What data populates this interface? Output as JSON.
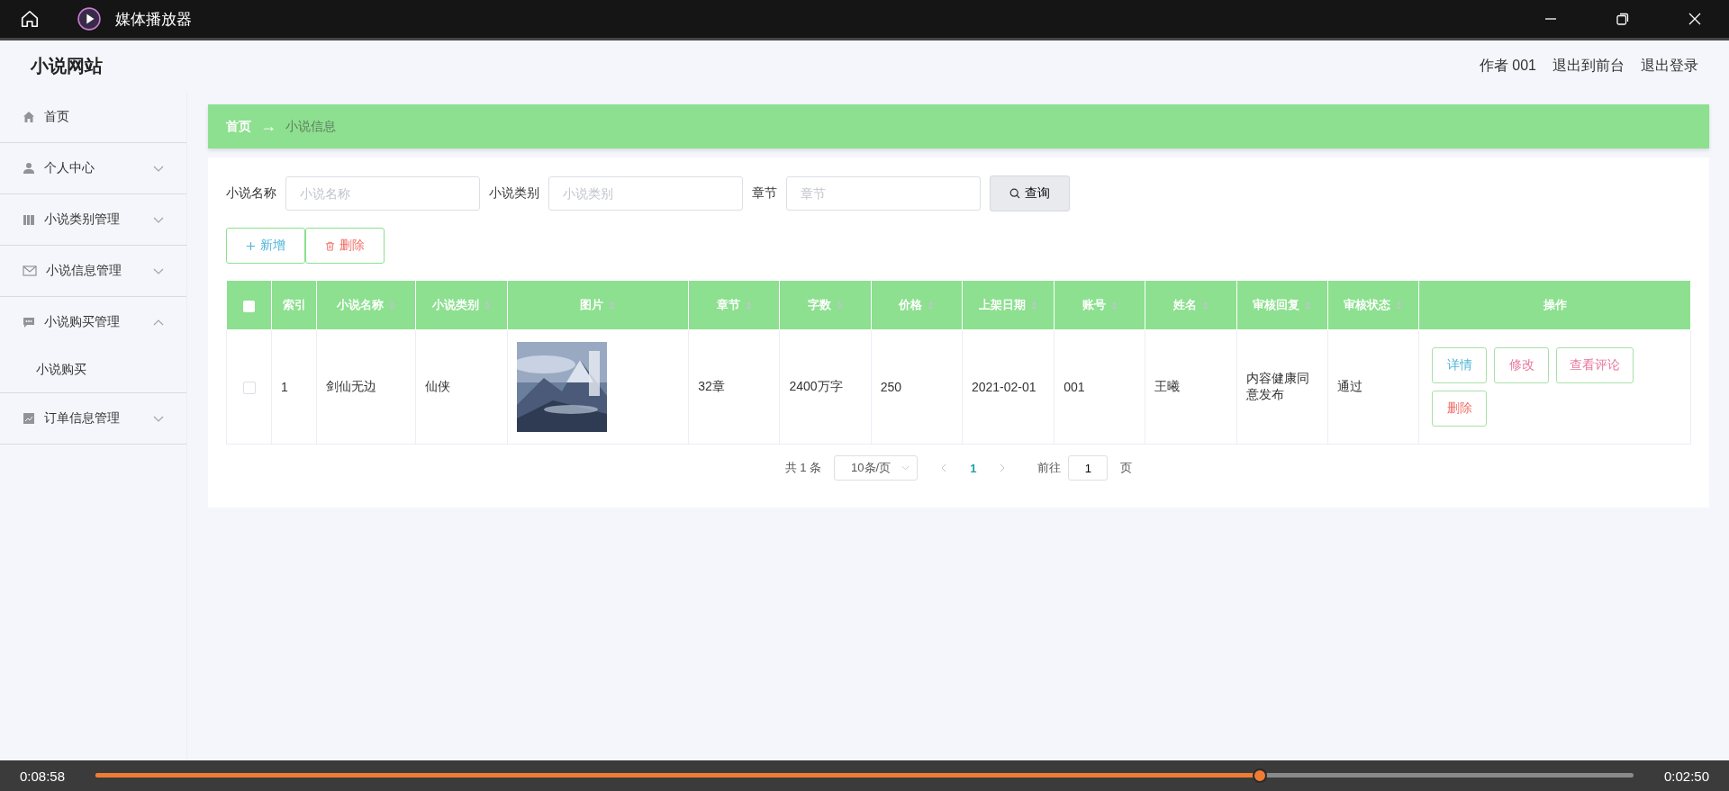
{
  "window": {
    "title": "媒体播放器"
  },
  "header": {
    "site_title": "小说网站",
    "user": "作者 001",
    "links": [
      "退出到前台",
      "退出登录"
    ]
  },
  "sidebar": {
    "items": [
      {
        "label": "首页"
      },
      {
        "label": "个人中心",
        "expanded": false
      },
      {
        "label": "小说类别管理",
        "expanded": false
      },
      {
        "label": "小说信息管理",
        "expanded": false
      },
      {
        "label": "小说购买管理",
        "expanded": true,
        "children": [
          {
            "label": "小说购买"
          }
        ]
      },
      {
        "label": "订单信息管理",
        "expanded": false
      }
    ]
  },
  "breadcrumb": [
    "首页",
    "→",
    "小说信息"
  ],
  "filters": [
    {
      "label": "小说名称",
      "placeholder": "小说名称"
    },
    {
      "label": "小说类别",
      "placeholder": "小说类别"
    },
    {
      "label": "章节",
      "placeholder": "章节"
    }
  ],
  "search_button": "查询",
  "actions": [
    {
      "kind": "add",
      "label": "新增"
    },
    {
      "kind": "delete",
      "label": "删除"
    }
  ],
  "table": {
    "header_checked": false,
    "columns": [
      {
        "label": "索引",
        "sortable": false
      },
      {
        "label": "小说名称",
        "sortable": true
      },
      {
        "label": "小说类别",
        "sortable": true
      },
      {
        "label": "图片",
        "sortable": true
      },
      {
        "label": "章节",
        "sortable": true
      },
      {
        "label": "字数",
        "sortable": true
      },
      {
        "label": "价格",
        "sortable": true
      },
      {
        "label": "上架日期",
        "sortable": true
      },
      {
        "label": "账号",
        "sortable": true
      },
      {
        "label": "姓名",
        "sortable": true
      },
      {
        "label": "审核回复",
        "sortable": true
      },
      {
        "label": "审核状态",
        "sortable": true
      },
      {
        "label": "操作",
        "sortable": false
      }
    ],
    "rows": [
      {
        "checked": false,
        "cells": [
          "1",
          "剑仙无边",
          "仙侠",
          {
            "kind": "picture"
          },
          "32章",
          "2400万字",
          "250",
          "2021-02-01",
          "001",
          "王曦",
          "内容健康同意发布",
          "通过"
        ],
        "buttons": [
          {
            "kind": "detail",
            "label": "详情"
          },
          {
            "kind": "edit",
            "label": "修改"
          },
          {
            "kind": "comments",
            "label": "查看评论"
          },
          {
            "kind": "delete",
            "label": "删除"
          }
        ]
      }
    ]
  },
  "pagination": {
    "total": "共 1 条",
    "page_size": "10条/页",
    "pages": [
      {
        "label": "1",
        "selected": true
      }
    ],
    "goto_label": "前往",
    "goto_value": "1",
    "goto_suffix": "页"
  },
  "player": {
    "elapsed": "0:08:58",
    "remaining": "0:02:50",
    "level": 0.757
  }
}
